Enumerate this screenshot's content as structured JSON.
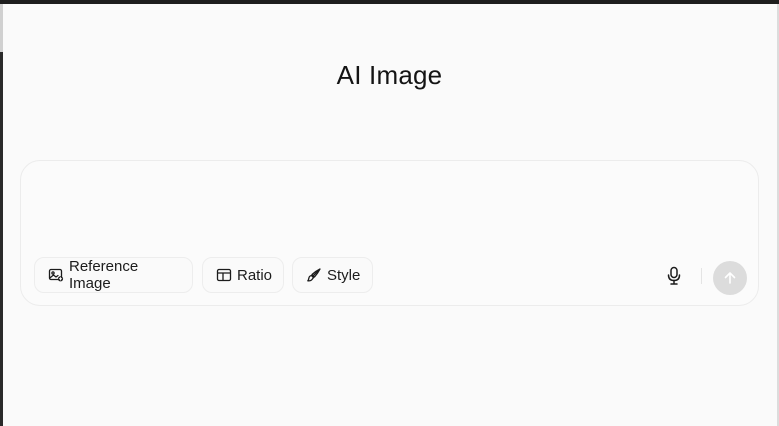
{
  "page": {
    "title": "AI Image"
  },
  "composer": {
    "placeholder": "",
    "chips": {
      "reference_image": {
        "label": "Reference Image",
        "icon": "image-upload-icon"
      },
      "ratio": {
        "label": "Ratio",
        "icon": "aspect-ratio-icon"
      },
      "style": {
        "label": "Style",
        "icon": "brush-icon"
      }
    },
    "mic_icon": "microphone-icon",
    "send_icon": "arrow-up-icon",
    "send_enabled": false
  },
  "colors": {
    "background": "#fafafa",
    "send_button_disabled": "#dcdcdc",
    "text": "#1a1a1a"
  }
}
